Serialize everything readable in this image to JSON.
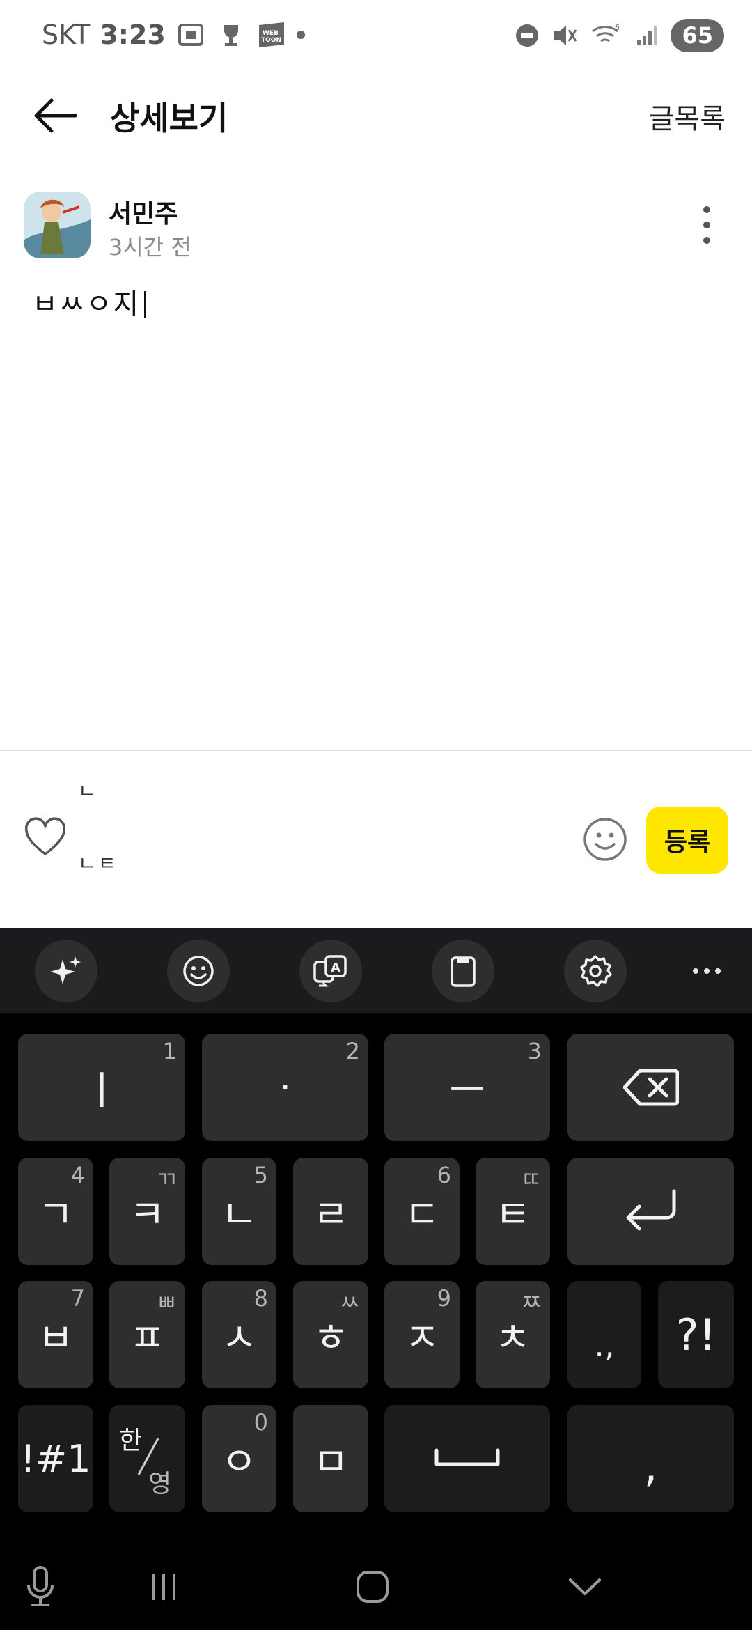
{
  "status_bar": {
    "carrier": "SKT",
    "time": "3:23",
    "battery": "65",
    "icons": [
      "screenshot-icon",
      "trophy-icon",
      "webtoon-icon",
      "dot-icon",
      "dnd-icon",
      "mute-icon",
      "wifi-icon",
      "signal-icon"
    ]
  },
  "header": {
    "title": "상세보기",
    "list_link": "글목록"
  },
  "post": {
    "author": "서민주",
    "time": "3시간 전",
    "body": "ㅂㅆㅇ지"
  },
  "comment_bar": {
    "line1": "ㄴ",
    "line2": "ㄴㅌ",
    "submit_label": "등록",
    "submit_color": "#ffe600"
  },
  "keyboard": {
    "toolbar_icons": [
      "ai-sparkle-icon",
      "emoji-icon",
      "translate-icon",
      "clipboard-icon",
      "settings-icon",
      "more-icon"
    ],
    "rows": [
      [
        {
          "label": "ㅣ",
          "hint": "1"
        },
        {
          "label": "·",
          "hint": "2"
        },
        {
          "label": "ㅡ",
          "hint": "3"
        },
        {
          "label": "backspace"
        }
      ],
      [
        {
          "label": "ㄱ",
          "hint": "4"
        },
        {
          "label": "ㅋ",
          "hint": "ㄲ"
        },
        {
          "label": "ㄴ",
          "hint": "5"
        },
        {
          "label": "ㄹ",
          "hint": ""
        },
        {
          "label": "ㄷ",
          "hint": "6"
        },
        {
          "label": "ㅌ",
          "hint": "ㄸ"
        },
        {
          "label": "enter"
        }
      ],
      [
        {
          "label": "ㅂ",
          "hint": "7"
        },
        {
          "label": "ㅍ",
          "hint": "ㅃ"
        },
        {
          "label": "ㅅ",
          "hint": "8"
        },
        {
          "label": "ㅎ",
          "hint": "ㅆ"
        },
        {
          "label": "ㅈ",
          "hint": "9"
        },
        {
          "label": "ㅊ",
          "hint": "ㅉ"
        },
        {
          "label": ".,"
        },
        {
          "label": "?!"
        }
      ],
      [
        {
          "label": "!#1"
        },
        {
          "label": "한/영"
        },
        {
          "label": "ㅇ",
          "hint": "0"
        },
        {
          "label": "ㅁ"
        },
        {
          "label": "space"
        },
        {
          "label": ","
        }
      ]
    ],
    "keys": {
      "k1": "ㅣ",
      "k1h": "1",
      "k2": "·",
      "k2h": "2",
      "k3": "ㅡ",
      "k3h": "3",
      "k4": "ㄱ",
      "k4h": "4",
      "k5": "ㅋ",
      "k5h": "ㄲ",
      "k6": "ㄴ",
      "k6h": "5",
      "k7": "ㄹ",
      "k8": "ㄷ",
      "k8h": "6",
      "k9": "ㅌ",
      "k9h": "ㄸ",
      "k10": "ㅂ",
      "k10h": "7",
      "k11": "ㅍ",
      "k11h": "ㅃ",
      "k12": "ㅅ",
      "k12h": "8",
      "k13": "ㅎ",
      "k13h": "ㅆ",
      "k14": "ㅈ",
      "k14h": "9",
      "k15": "ㅊ",
      "k15h": "ㅉ",
      "k16": ".,",
      "k17": "?!",
      "k18": "!#1",
      "k19a": "한",
      "k19b": "영",
      "k20": "ㅇ",
      "k20h": "0",
      "k21": "ㅁ",
      "k22": ","
    }
  },
  "nav_bar": {
    "icons": [
      "mic-icon",
      "recent-apps-icon",
      "home-icon",
      "hide-keyboard-icon"
    ]
  }
}
